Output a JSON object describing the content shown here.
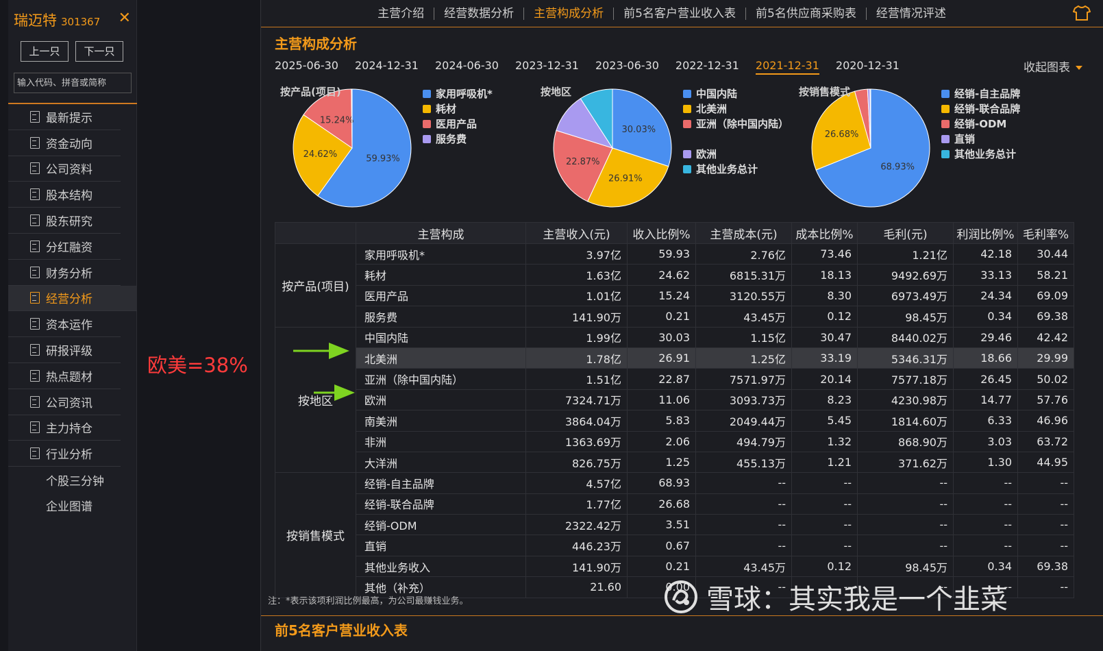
{
  "stock": {
    "name": "瑞迈特",
    "code": "301367"
  },
  "sidebar": {
    "prev_label": "上一只",
    "next_label": "下一只",
    "search_placeholder": "输入代码、拼音或简称",
    "items": [
      {
        "label": "最新提示"
      },
      {
        "label": "资金动向"
      },
      {
        "label": "公司资料"
      },
      {
        "label": "股本结构"
      },
      {
        "label": "股东研究"
      },
      {
        "label": "分红融资"
      },
      {
        "label": "财务分析"
      },
      {
        "label": "经营分析",
        "active": true
      },
      {
        "label": "资本运作"
      },
      {
        "label": "研报评级"
      },
      {
        "label": "热点题材"
      },
      {
        "label": "公司资讯"
      },
      {
        "label": "主力持仓"
      },
      {
        "label": "行业分析"
      }
    ],
    "extra_items": [
      "个股三分钟",
      "企业图谱"
    ]
  },
  "annotation": "欧美=38%",
  "tabs": [
    "主营介绍",
    "经营数据分析",
    "主营构成分析",
    "前5名客户营业收入表",
    "前5名供应商采购表",
    "经营情况评述"
  ],
  "active_tab": 2,
  "section_title": "主营构成分析",
  "next_section_title": "前5名客户营业收入表",
  "dates": [
    "2025-06-30",
    "2024-12-31",
    "2024-06-30",
    "2023-12-31",
    "2023-06-30",
    "2022-12-31",
    "2021-12-31",
    "2020-12-31"
  ],
  "active_date": 6,
  "collapse_label": "收起图表",
  "pies": [
    {
      "title": "按产品(项目)",
      "slices": [
        {
          "label": "家用呼吸机*",
          "value": 59.93,
          "color": "#4a8ff0",
          "pct": "59.93%"
        },
        {
          "label": "耗材",
          "value": 24.62,
          "color": "#f5b800",
          "pct": "24.62%"
        },
        {
          "label": "医用产品",
          "value": 15.24,
          "color": "#ea6b6b",
          "pct": "15.24%"
        },
        {
          "label": "服务费",
          "value": 0.21,
          "color": "#a99af0",
          "pct": ""
        }
      ]
    },
    {
      "title": "按地区",
      "slices": [
        {
          "label": "中国内陆",
          "value": 30.03,
          "color": "#4a8ff0",
          "pct": "30.03%"
        },
        {
          "label": "北美洲",
          "value": 26.91,
          "color": "#f5b800",
          "pct": "26.91%"
        },
        {
          "label": "亚洲（除中国内陆）",
          "value": 22.87,
          "color": "#ea6b6b",
          "pct": "22.87%"
        },
        {
          "label": "欧洲",
          "value": 11.06,
          "color": "#a99af0",
          "pct": ""
        },
        {
          "label": "其他业务总计",
          "value": 9.13,
          "color": "#38b6e0",
          "pct": ""
        }
      ]
    },
    {
      "title": "按销售模式",
      "slices": [
        {
          "label": "经销-自主品牌",
          "value": 68.93,
          "color": "#4a8ff0",
          "pct": "68.93%"
        },
        {
          "label": "经销-联合品牌",
          "value": 26.68,
          "color": "#f5b800",
          "pct": "26.68%"
        },
        {
          "label": "经销-ODM",
          "value": 3.51,
          "color": "#ea6b6b",
          "pct": ""
        },
        {
          "label": "直销",
          "value": 0.67,
          "color": "#a99af0",
          "pct": ""
        },
        {
          "label": "其他业务总计",
          "value": 0.21,
          "color": "#38b6e0",
          "pct": ""
        }
      ]
    }
  ],
  "table": {
    "headers": [
      "",
      "主营构成",
      "主营收入(元)",
      "收入比例%",
      "主营成本(元)",
      "成本比例%",
      "毛利(元)",
      "利润比例%",
      "毛利率%"
    ],
    "groups": [
      {
        "name": "按产品(项目)",
        "rows": [
          [
            "家用呼吸机*",
            "3.97亿",
            "59.93",
            "2.76亿",
            "73.46",
            "1.21亿",
            "42.18",
            "30.44"
          ],
          [
            "耗材",
            "1.63亿",
            "24.62",
            "6815.31万",
            "18.13",
            "9492.69万",
            "33.13",
            "58.21"
          ],
          [
            "医用产品",
            "1.01亿",
            "15.24",
            "3120.55万",
            "8.30",
            "6973.49万",
            "24.34",
            "69.09"
          ],
          [
            "服务费",
            "141.90万",
            "0.21",
            "43.45万",
            "0.12",
            "98.45万",
            "0.34",
            "69.38"
          ]
        ]
      },
      {
        "name": "按地区",
        "rows": [
          [
            "中国内陆",
            "1.99亿",
            "30.03",
            "1.15亿",
            "30.47",
            "8440.02万",
            "29.46",
            "42.42"
          ],
          [
            "北美洲",
            "1.78亿",
            "26.91",
            "1.25亿",
            "33.19",
            "5346.31万",
            "18.66",
            "29.99"
          ],
          [
            "亚洲（除中国内陆）",
            "1.51亿",
            "22.87",
            "7571.97万",
            "20.14",
            "7577.18万",
            "26.45",
            "50.02"
          ],
          [
            "欧洲",
            "7324.71万",
            "11.06",
            "3093.73万",
            "8.23",
            "4230.98万",
            "14.77",
            "57.76"
          ],
          [
            "南美洲",
            "3864.04万",
            "5.83",
            "2049.44万",
            "5.45",
            "1814.60万",
            "6.33",
            "46.96"
          ],
          [
            "非洲",
            "1363.69万",
            "2.06",
            "494.79万",
            "1.32",
            "868.90万",
            "3.03",
            "63.72"
          ],
          [
            "大洋洲",
            "826.75万",
            "1.25",
            "455.13万",
            "1.21",
            "371.62万",
            "1.30",
            "44.95"
          ]
        ]
      },
      {
        "name": "按销售模式",
        "rows": [
          [
            "经销-自主品牌",
            "4.57亿",
            "68.93",
            "--",
            "--",
            "--",
            "--",
            "--"
          ],
          [
            "经销-联合品牌",
            "1.77亿",
            "26.68",
            "--",
            "--",
            "--",
            "--",
            "--"
          ],
          [
            "经销-ODM",
            "2322.42万",
            "3.51",
            "--",
            "--",
            "--",
            "--",
            "--"
          ],
          [
            "直销",
            "446.23万",
            "0.67",
            "--",
            "--",
            "--",
            "--",
            "--"
          ],
          [
            "其他业务收入",
            "141.90万",
            "0.21",
            "43.45万",
            "0.12",
            "98.45万",
            "0.34",
            "69.38"
          ],
          [
            "其他（补充）",
            "21.60",
            "0.00",
            "--",
            "--",
            "--",
            "--",
            "--"
          ]
        ]
      }
    ],
    "highlight_row": "北美洲"
  },
  "note": "注：*表示该项利润比例最高，为公司最赚钱业务。",
  "watermark": "雪球：其实我是一个韭菜",
  "colors": {
    "accent": "#f39a1a",
    "arrow": "#7ed321",
    "annotation": "#ff3b3b"
  }
}
